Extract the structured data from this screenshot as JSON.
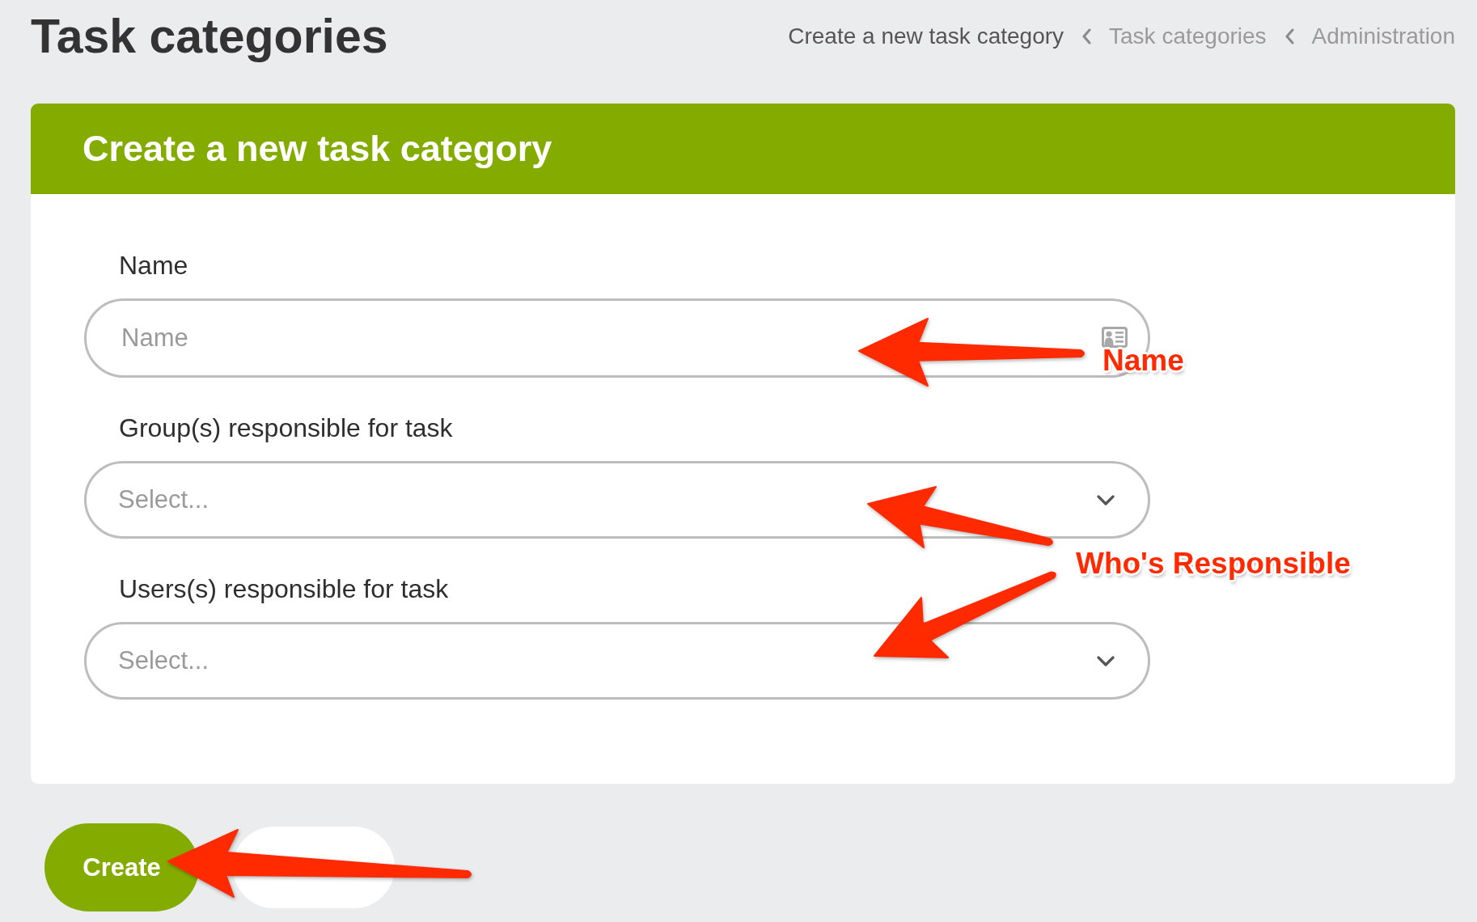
{
  "page": {
    "title": "Task categories"
  },
  "breadcrumbs": [
    {
      "label": "Create a new task category",
      "current": true
    },
    {
      "label": "Task categories",
      "current": false
    },
    {
      "label": "Administration",
      "current": false
    }
  ],
  "form": {
    "title": "Create a new task category",
    "fields": [
      {
        "kind": "text",
        "label": "Name",
        "placeholder": "Name"
      },
      {
        "kind": "select",
        "label": "Group(s) responsible for task",
        "placeholder": "Select..."
      },
      {
        "kind": "select",
        "label": "Users(s) responsible for task",
        "placeholder": "Select..."
      }
    ]
  },
  "buttons": [
    {
      "kind": "primary",
      "label": "Create"
    },
    {
      "kind": "secondary"
    }
  ],
  "annotations": [
    {
      "kind": "callout",
      "text": "Name"
    },
    {
      "kind": "callout",
      "text": "Who's Responsible"
    },
    {
      "kind": "arrow"
    }
  ]
}
